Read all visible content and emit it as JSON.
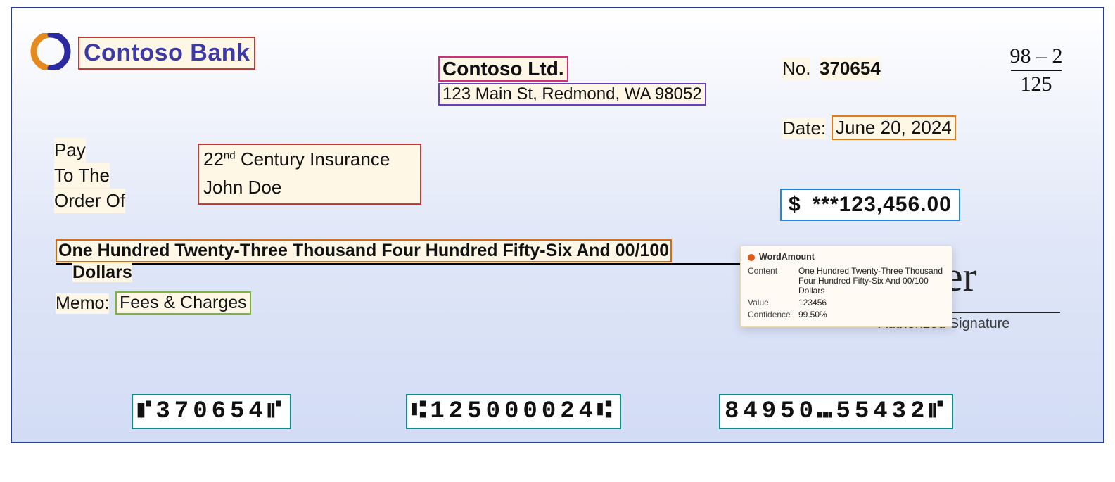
{
  "bank": {
    "name": "Contoso Bank"
  },
  "drawer": {
    "name": "Contoso Ltd.",
    "address": "123 Main St, Redmond, WA 98052"
  },
  "check_number": {
    "label": "No.",
    "value": "370654"
  },
  "fraction": {
    "top": "98 – 2",
    "bottom": "125"
  },
  "date": {
    "label": "Date:",
    "value": "June 20, 2024"
  },
  "pay_to": {
    "line1": "Pay",
    "line2": "To The",
    "line3": "Order Of",
    "payee_line1_prefix": "22",
    "payee_line1_sup": "nd",
    "payee_line1_rest": " Century Insurance",
    "payee_line2": "John Doe"
  },
  "amount": {
    "symbol": "$",
    "numeric": "***123,456.00"
  },
  "amount_words": {
    "value": "One Hundred Twenty-Three Thousand Four Hundred Fifty-Six And 00/100",
    "suffix": "Dollars"
  },
  "memo": {
    "label": "Memo:",
    "value": "Fees & Charges"
  },
  "signature": {
    "script": "lker",
    "label": "Authorized Signature"
  },
  "micr": {
    "seg1": "⑈370654⑈",
    "seg2": "⑆125000024⑆",
    "seg3": "84950⑉55432⑈"
  },
  "tooltip": {
    "title": "WordAmount",
    "content_label": "Content",
    "content": "One Hundred Twenty-Three Thousand Four Hundred Fifty-Six And 00/100 Dollars",
    "value_label": "Value",
    "value": "123456",
    "confidence_label": "Confidence",
    "confidence": "99.50%"
  },
  "colors": {
    "box_red": "#c63a3a",
    "box_pink": "#d22d7e",
    "box_purple": "#6a3fbf",
    "box_orange": "#e07b22",
    "box_blue": "#1e88e5",
    "box_green": "#7cb342",
    "box_teal": "#0f8d8d"
  }
}
